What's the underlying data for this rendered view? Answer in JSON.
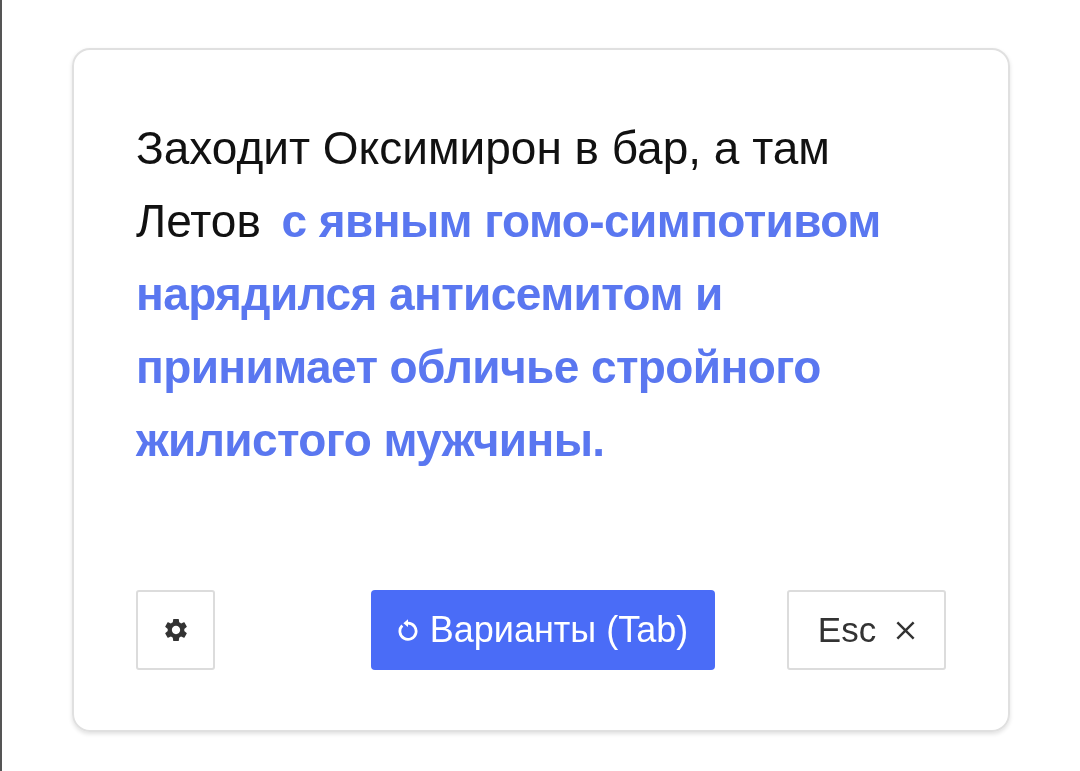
{
  "story": {
    "prompt": "Заходит Оксимирон в бар, а там Летов",
    "generated": "с явным гомо-симпотивом нарядился антисемитом и принимает обличье стройного жилистого мужчины."
  },
  "toolbar": {
    "buttons": [
      {
        "kind": "settings"
      },
      {
        "kind": "primary",
        "label": "Варианты (Tab)"
      },
      {
        "kind": "close",
        "label": "Esc"
      }
    ]
  }
}
